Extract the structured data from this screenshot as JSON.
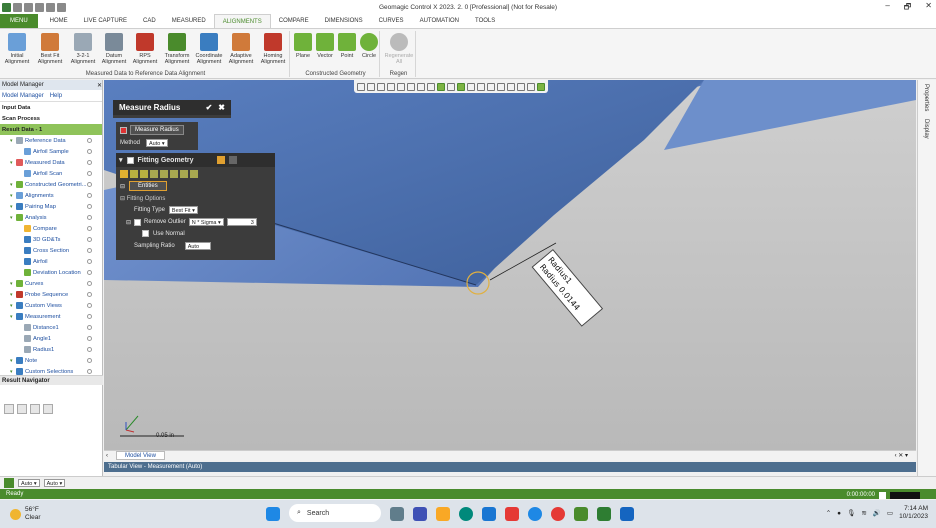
{
  "app": {
    "title": "Geomagic Control X 2023. 2. 0 [Professional] (Not for Resale)"
  },
  "window_controls": [
    "–",
    "🗗",
    "✕"
  ],
  "tabs": [
    {
      "label": "MENU"
    },
    {
      "label": "HOME"
    },
    {
      "label": "LIVE CAPTURE"
    },
    {
      "label": "CAD"
    },
    {
      "label": "MEASURED"
    },
    {
      "label": "ALIGNMENTS"
    },
    {
      "label": "COMPARE"
    },
    {
      "label": "DIMENSIONS"
    },
    {
      "label": "CURVES"
    },
    {
      "label": "AUTOMATION"
    },
    {
      "label": "TOOLS"
    }
  ],
  "ribbon": {
    "group1": {
      "label": "Measured Data to Reference Data Alignment",
      "buttons": [
        {
          "label": "Initial Alignment",
          "color": "#6a9fd8"
        },
        {
          "label": "Best Fit Alignment",
          "color": "#d07a3a"
        },
        {
          "label": "3-2-1 Alignment",
          "color": "#9aa8b5"
        },
        {
          "label": "Datum Alignment",
          "color": "#7a8a99"
        },
        {
          "label": "RPS Alignment",
          "color": "#c0392b"
        },
        {
          "label": "Transform Alignment",
          "color": "#4a8b2c"
        },
        {
          "label": "Coordinate Alignment",
          "color": "#3a7dc0"
        },
        {
          "label": "Adaptive Alignment",
          "color": "#d07a3a"
        },
        {
          "label": "Homing Alignment",
          "color": "#c0392b"
        }
      ]
    },
    "group2": {
      "label": "Constructed Geometry",
      "buttons": [
        {
          "label": "Plane",
          "color": "#6fb23a"
        },
        {
          "label": "Vector",
          "color": "#6fb23a"
        },
        {
          "label": "Point",
          "color": "#6fb23a"
        },
        {
          "label": "Circle",
          "color": "#6fb23a"
        }
      ]
    },
    "group3": {
      "label": "Regen",
      "buttons": [
        {
          "label": "Regenerate All",
          "color": "#bbbbbb"
        }
      ]
    }
  },
  "model_manager": {
    "header": "Model Manager",
    "tabs": [
      "Model Manager",
      "Help"
    ],
    "items": [
      {
        "label": "Input Data",
        "bold": true
      },
      {
        "label": "Scan Process",
        "bold": true
      },
      {
        "label": "Result Data - 1",
        "highlight": true
      },
      {
        "label": "Reference Data",
        "indent": 1,
        "color": "#9aa8b5"
      },
      {
        "label": "Airfoil Sample",
        "indent": 2,
        "color": "#6a9fd8"
      },
      {
        "label": "Measured Data",
        "indent": 1,
        "color": "#e05a5a"
      },
      {
        "label": "Airfoil Scan",
        "indent": 2,
        "color": "#6a9fd8"
      },
      {
        "label": "Constructed Geometri...",
        "indent": 1,
        "color": "#6fb23a"
      },
      {
        "label": "Alignments",
        "indent": 1,
        "color": "#6a9fd8"
      },
      {
        "label": "Pairing Map",
        "indent": 1,
        "color": "#3a7dc0"
      },
      {
        "label": "Analysis",
        "indent": 1,
        "color": "#6fb23a"
      },
      {
        "label": "Compare",
        "indent": 2,
        "color": "#f0b531"
      },
      {
        "label": "3D GD&Ts",
        "indent": 2,
        "color": "#3a7dc0"
      },
      {
        "label": "Cross Section",
        "indent": 2,
        "color": "#3a7dc0"
      },
      {
        "label": "Airfoil",
        "indent": 2,
        "color": "#3a7dc0"
      },
      {
        "label": "Deviation Location",
        "indent": 2,
        "color": "#6fb23a"
      },
      {
        "label": "Curves",
        "indent": 1,
        "color": "#6fb23a"
      },
      {
        "label": "Probe Sequence",
        "indent": 1,
        "color": "#c0392b"
      },
      {
        "label": "Custom Views",
        "indent": 1,
        "color": "#3a7dc0"
      },
      {
        "label": "Measurement",
        "indent": 1,
        "color": "#3a7dc0"
      },
      {
        "label": "Distance1",
        "indent": 2,
        "color": "#9aa8b5"
      },
      {
        "label": "Angle1",
        "indent": 2,
        "color": "#9aa8b5"
      },
      {
        "label": "Radius1",
        "indent": 2,
        "color": "#9aa8b5"
      },
      {
        "label": "Note",
        "indent": 1,
        "color": "#3a7dc0"
      },
      {
        "label": "Custom Selections",
        "indent": 1,
        "color": "#3a7dc0"
      }
    ],
    "result_navigator": "Result Navigator"
  },
  "measure_radius": {
    "title": "Measure Radius",
    "section": "Measure Radius",
    "method_label": "Method",
    "method_value": "Auto"
  },
  "fitting_geometry": {
    "title": "Fitting Geometry",
    "entities_label": "Entities",
    "options_label": "Fitting Options",
    "fitting_type_label": "Fitting Type",
    "fitting_type_value": "Best Fit",
    "remove_outlier_label": "Remove Outlier",
    "remove_outlier_value": "N * Sigma",
    "remove_outlier_num": "3",
    "use_normal_label": "Use Normal",
    "sampling_ratio_label": "Sampling Ratio",
    "sampling_ratio_value": "Auto"
  },
  "annotation": {
    "line1": "Radius1",
    "line2": "Radius   0.0144"
  },
  "scale": {
    "label": "0.05 in"
  },
  "model_view": {
    "tab": "Model View"
  },
  "tabular_view": {
    "label": "Tabular View - Measurement (Auto)"
  },
  "bottom_controls": [
    "Auto",
    "Auto"
  ],
  "status": {
    "text": "Ready",
    "time": "0:00:00:00"
  },
  "properties_strip": [
    "Properties",
    "Display"
  ],
  "taskbar": {
    "temp": "56°F",
    "condition": "Clear",
    "search_placeholder": "Search",
    "time": "7:14 AM",
    "date": "10/1/2023"
  }
}
